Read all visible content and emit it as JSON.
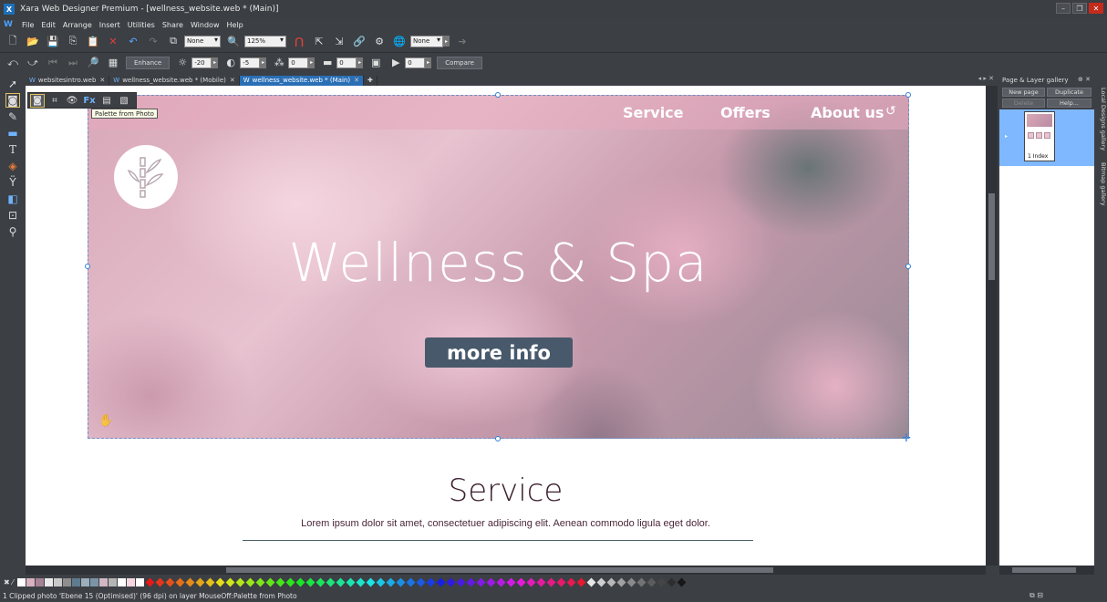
{
  "window": {
    "title": "Xara Web Designer Premium - [wellness_website.web * (Main)]",
    "logo": "X",
    "controls": [
      "minimize-icon",
      "restore-icon",
      "close-icon"
    ]
  },
  "menu": {
    "app_letter": "W",
    "items": [
      "File",
      "Edit",
      "Arrange",
      "Insert",
      "Utilities",
      "Share",
      "Window",
      "Help"
    ]
  },
  "toolbar1": {
    "select1": "None",
    "zoom": "125%",
    "select2": "None"
  },
  "toolbar2": {
    "enhance_label": "Enhance",
    "brightness": "-20",
    "contrast": "-5",
    "saturation": "0",
    "tone": "0",
    "play_value": "0",
    "compare_label": "Compare"
  },
  "tabs": [
    {
      "label": "websitesintro.web",
      "active": false
    },
    {
      "label": "wellness_website.web * (Mobile)",
      "active": false
    },
    {
      "label": "wellness_website.web * (Main)",
      "active": true
    }
  ],
  "photo_bar": {
    "fx_label": "Fx",
    "tooltip": "Palette from Photo"
  },
  "website": {
    "nav": [
      "Service",
      "Offers",
      "About us"
    ],
    "hero_title": "Wellness & Spa",
    "button": "more info",
    "section_title": "Service",
    "section_text": "Lorem ipsum dolor sit amet, consectetuer adipiscing elit. Aenean commodo ligula eget dolor."
  },
  "gallery": {
    "title": "Page & Layer gallery",
    "buttons": [
      "New page",
      "Duplicate",
      "Delete",
      "Help..."
    ],
    "page_label": "1 Index",
    "side_tabs": [
      "Local Designs gallery",
      "Bitmap gallery"
    ]
  },
  "status": {
    "prefix": "1 Clipped photo 'Ebene 15 (Optimised)' (96 dpi) on layer MouseOff: ",
    "hint": "Palette from Photo"
  },
  "colors": {
    "accent": "#2a6fb5",
    "button_bg": "#47596b",
    "section_text": "#4a2636",
    "palette": [
      "#ffffff",
      "#d8b0c0",
      "#a58294",
      "#eaeaea",
      "#c9c9c9",
      "#8e8e8e",
      "#5e7b8f",
      "#9aaebb",
      "#7c95a6",
      "#d0b8c4",
      "#b5b5b5",
      "#ffffff",
      "#f5d6e0",
      "#ffffff"
    ]
  }
}
